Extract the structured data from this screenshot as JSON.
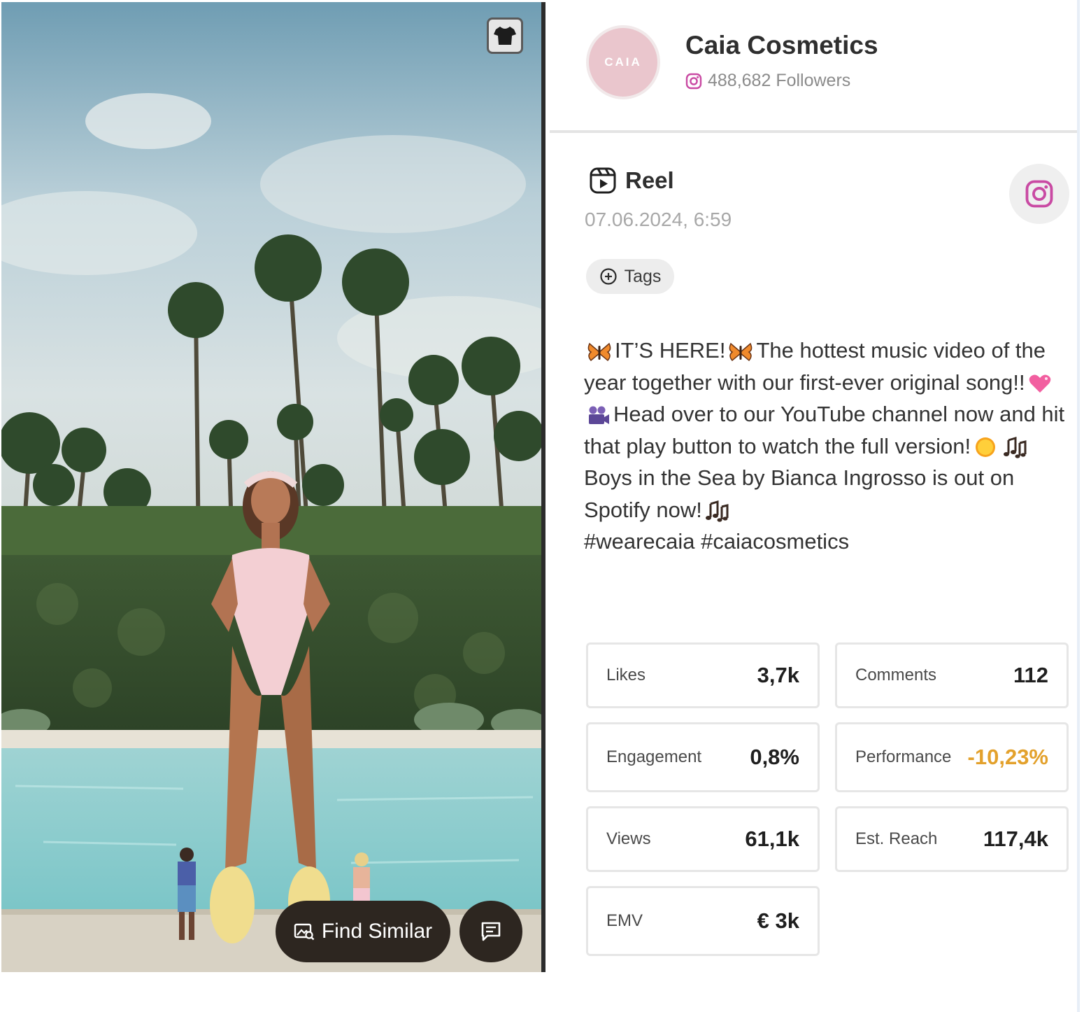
{
  "brand": {
    "name": "Caia Cosmetics",
    "avatar_text": "CAIA",
    "followers": "488,682 Followers",
    "followers_icon": "instagram-icon",
    "accent": "#c94aa3"
  },
  "post": {
    "type_label": "Reel",
    "type_icon": "reel-icon",
    "date": "07.06.2024, 6:59",
    "platform_icon": "instagram-icon",
    "tags_label": "Tags",
    "caption": {
      "p1": "IT’S HERE!",
      "p2": "The hottest music video of the year together with our first-ever original song!!",
      "p3": "Head over to our YouTube channel now and hit that play button to watch the full version!",
      "p4": "Boys in the Sea by Bianca Ingrosso is out on Spotify now!",
      "p5": "#wearecaia #caiacosmetics"
    }
  },
  "media": {
    "shirt_icon": "tshirt-icon",
    "find_similar_label": "Find Similar",
    "comment_icon": "comment-icon"
  },
  "stats": [
    {
      "label": "Likes",
      "value": "3,7k"
    },
    {
      "label": "Comments",
      "value": "112"
    },
    {
      "label": "Engagement",
      "value": "0,8%"
    },
    {
      "label": "Performance",
      "value": "-10,23%",
      "color": "#e3a12c"
    },
    {
      "label": "Views",
      "value": "61,1k"
    },
    {
      "label": "Est. Reach",
      "value": "117,4k"
    },
    {
      "label": "EMV",
      "value": "€ 3k"
    }
  ]
}
